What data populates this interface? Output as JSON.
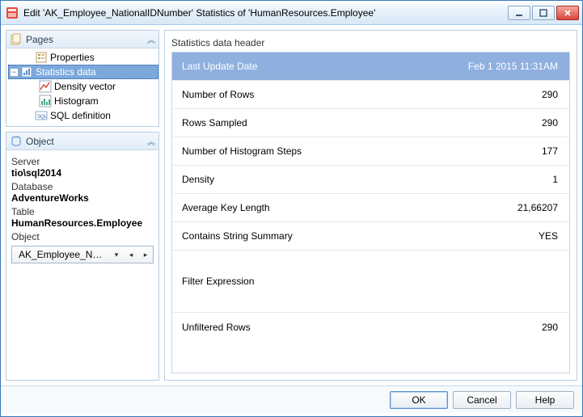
{
  "window": {
    "title": "Edit 'AK_Employee_NationalIDNumber' Statistics of 'HumanResources.Employee'"
  },
  "pages_panel": {
    "title": "Pages",
    "items": {
      "properties": "Properties",
      "statistics_data": "Statistics data",
      "density_vector": "Density vector",
      "histogram": "Histogram",
      "sql_definition": "SQL definition"
    }
  },
  "object_panel": {
    "title": "Object",
    "labels": {
      "server": "Server",
      "database": "Database",
      "table": "Table",
      "object": "Object"
    },
    "values": {
      "server": "tio\\sql2014",
      "database": "AdventureWorks",
      "table": "HumanResources.Employee",
      "object_short": "AK_Employee_Natio..."
    }
  },
  "main": {
    "section_title": "Statistics data header",
    "rows": [
      {
        "name": "Last Update Date",
        "value": "Feb  1 2015 11:31AM"
      },
      {
        "name": "Number of Rows",
        "value": "290"
      },
      {
        "name": "Rows Sampled",
        "value": "290"
      },
      {
        "name": "Number of Histogram Steps",
        "value": "177"
      },
      {
        "name": "Density",
        "value": "1"
      },
      {
        "name": "Average Key Length",
        "value": "21,66207"
      },
      {
        "name": "Contains String Summary",
        "value": "YES"
      },
      {
        "name": "Filter Expression",
        "value": ""
      },
      {
        "name": "Unfiltered Rows",
        "value": "290"
      }
    ]
  },
  "buttons": {
    "ok": "OK",
    "cancel": "Cancel",
    "help": "Help"
  }
}
